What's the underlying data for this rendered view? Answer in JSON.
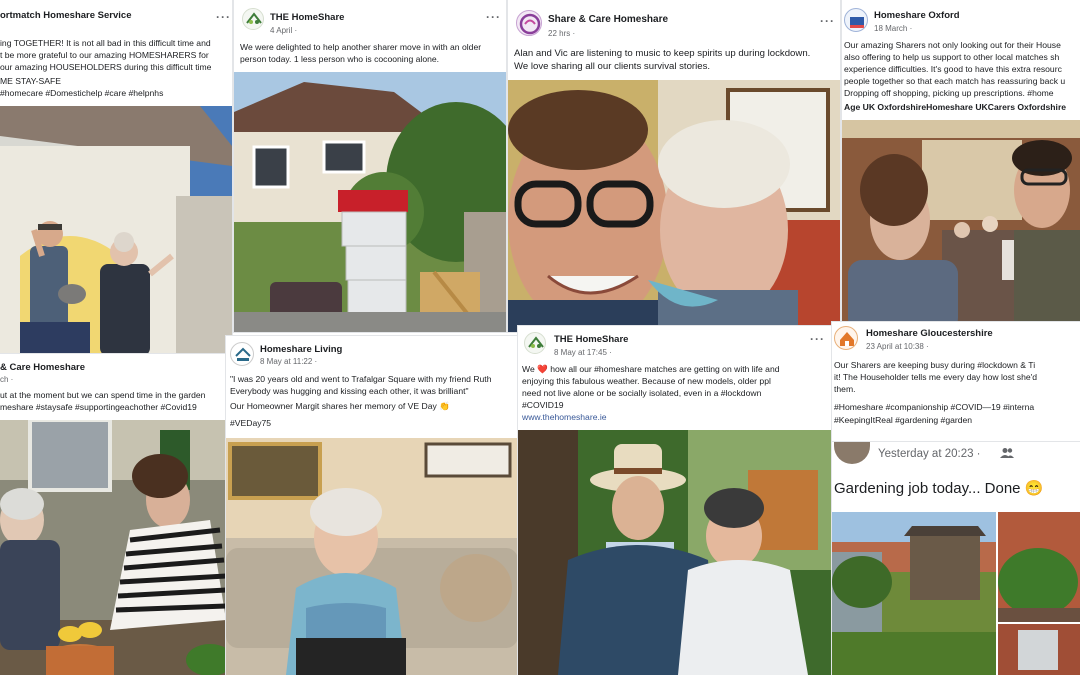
{
  "posts": [
    {
      "page": "ortmatch Homeshare Service",
      "date": "",
      "lines": [
        "ing TOGETHER! It is not all bad in this difficult time and",
        "t be more grateful to our amazing HOMESHARERS for",
        "our amazing HOUSEHOLDERS during this difficult time",
        "ME STAY-SAFE",
        "#homecare #Domestichelp #care #helpnhs"
      ]
    },
    {
      "page": "THE HomeShare",
      "date": "4 April ·",
      "lines": [
        "We were delighted to help another sharer move in with an older",
        "person today. 1 less person who is cocooning alone."
      ]
    },
    {
      "page": "Share & Care Homeshare",
      "date": "22 hrs ·",
      "lines": [
        "Alan and Vic are listening to music to keep spirits up during lockdown.",
        "We love sharing all our clients survival stories."
      ]
    },
    {
      "page": "Homeshare Oxford",
      "date": "18 March ·",
      "lines": [
        "Our amazing Sharers not only looking out for their House",
        "also offering to help us support to other local matches sh",
        "experience difficulties. It's good to have this extra resourc",
        "people together so that each match has reassuring back u",
        "Dropping off shopping, picking up prescriptions.  #home"
      ],
      "tags_line": "Age UK OxfordshireHomeshare UKCarers Oxfordshire"
    },
    {
      "page": "& Care Homeshare",
      "date": "ch ·",
      "lines": [
        "ut at the moment but we can spend time in the garden",
        "meshare #staysafe #supportingeachother #Covid19"
      ]
    },
    {
      "page": "Homeshare Living",
      "date": "8 May at 11:22 ·",
      "lines": [
        "\"I was 20 years old and went to Trafalgar Square with my friend Ruth",
        "Everybody was hugging and kissing each other, it was brilliant\"",
        "Our Homeowner Margit shares her memory of VE Day 👏",
        "",
        "#VEDay75"
      ]
    },
    {
      "page": "THE HomeShare",
      "date": "8 May at 17:45 ·",
      "lines": [
        "We ❤️ how all our #homeshare matches are getting on with life and",
        "enjoying this fabulous weather.  Because of new models, older ppl",
        "need not live alone or be socially isolated, even in a #lockdown",
        "#COVID19"
      ],
      "link": "www.thehomeshare.ie"
    },
    {
      "page": "Homeshare Gloucestershire",
      "date": "23 April at 10:38 ·",
      "lines": [
        "Our Sharers are keeping busy during #lockdown & Ti",
        "it! The Householder tells me every day how lost she'd",
        "them.",
        "",
        "#Homeshare #companionship #COVID—19 #interna",
        "#KeepingItReal #gardening #garden"
      ]
    }
  ],
  "comment": {
    "time": "Yesterday at 20:23 ·",
    "text": "Gardening job today... Done 😁"
  },
  "menu_glyph": "···",
  "logo_text": {
    "homeshare_small": "THE HomeShare",
    "oxford": "homeshare",
    "living": "HOMESHARE LIVING",
    "glos": "homeshare"
  },
  "colors": {
    "text": "#1c1e21",
    "meta": "#65676b",
    "link": "#385898",
    "homeshare_green": "#3e7d3a"
  }
}
